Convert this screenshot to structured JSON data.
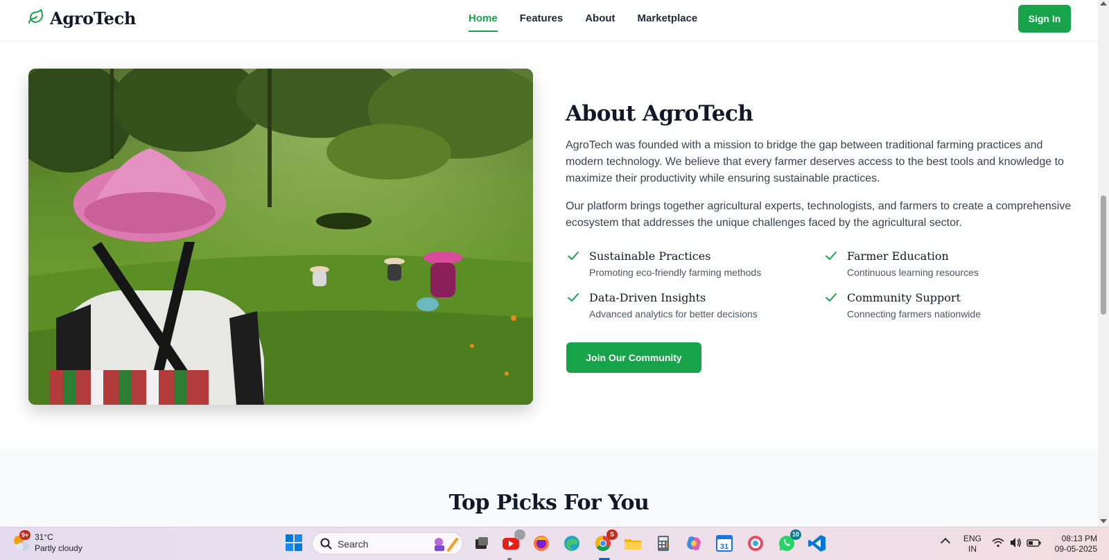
{
  "brand": {
    "name": "AgroTech"
  },
  "nav": {
    "links": [
      {
        "label": "Home",
        "active": true
      },
      {
        "label": "Features"
      },
      {
        "label": "About"
      },
      {
        "label": "Marketplace"
      }
    ],
    "signin_label": "Sign In"
  },
  "about": {
    "title": "About AgroTech",
    "paragraph1": "AgroTech was founded with a mission to bridge the gap between traditional farming practices and modern technology. We believe that every farmer deserves access to the best tools and knowledge to maximize their productivity while ensuring sustainable practices.",
    "paragraph2": "Our platform brings together agricultural experts, technologists, and farmers to create a comprehensive ecosystem that addresses the unique challenges faced by the agricultural sector.",
    "features": [
      {
        "title": "Sustainable Practices",
        "desc": "Promoting eco-friendly farming methods"
      },
      {
        "title": "Farmer Education",
        "desc": "Continuous learning resources"
      },
      {
        "title": "Data-Driven Insights",
        "desc": "Advanced analytics for better decisions"
      },
      {
        "title": "Community Support",
        "desc": "Connecting farmers nationwide"
      }
    ],
    "cta_label": "Join Our Community",
    "image_icon": "farmers-in-field-photo"
  },
  "picks": {
    "title": "Top Picks For You"
  },
  "taskbar": {
    "weather": {
      "temp": "31°C",
      "condition": "Partly cloudy",
      "badge": "9+"
    },
    "search_placeholder": "Search",
    "badges": {
      "youtube": "",
      "chrome": "S",
      "whatsapp": "10"
    },
    "calendar_day": "31",
    "lang": {
      "line1": "ENG",
      "line2": "IN"
    },
    "clock": {
      "time": "08:13 PM",
      "date": "09-05-2025"
    }
  },
  "colors": {
    "accent": "#16a34a",
    "section_bg": "#f8f9fa",
    "text_dark": "#111827",
    "text_body": "#374151"
  }
}
